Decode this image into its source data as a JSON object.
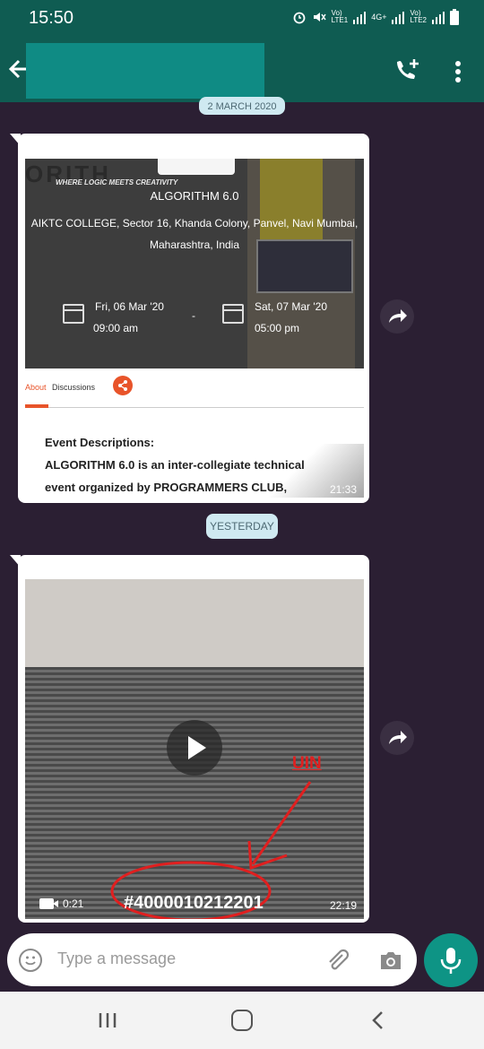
{
  "status_bar": {
    "time": "15:50",
    "sim1": "Vo)\nLTE1",
    "sim2": "Vo)\nLTE2",
    "network": "4G+"
  },
  "app_bar": {
    "back_icon": "arrow-left-icon",
    "call_icon": "add-call-icon",
    "menu_icon": "more-vertical-icon"
  },
  "chat": {
    "date_chip_1": "2 MARCH 2020",
    "message_1": {
      "image": {
        "brand_word": "ORITH",
        "tagline": "WHERE LOGIC MEETS CREATIVITY",
        "event_title": "ALGORITHM 6.0",
        "venue_line1": "AIKTC COLLEGE, Sector 16, Khanda Colony, Panvel, Navi Mumbai,",
        "venue_line2": "Maharashtra, India",
        "start_date": "Fri, 06 Mar '20",
        "start_time": "09:00 am",
        "separator": "-",
        "end_date": "Sat, 07 Mar '20",
        "end_time": "05:00 pm"
      },
      "tabs": {
        "about": "About",
        "discussions": "Discussions"
      },
      "desc_heading": "Event Descriptions:",
      "desc_line1": "ALGORITHM 6.0 is an inter-collegiate technical",
      "desc_line2": "event organized by PROGRAMMERS CLUB,",
      "timestamp": "21:33"
    },
    "date_chip_2": "YESTERDAY",
    "message_2": {
      "video_duration": "0:21",
      "timestamp": "22:19",
      "uin_code": "#4000010212201",
      "annotation_label": "UIN"
    }
  },
  "composer": {
    "placeholder": "Type a message"
  },
  "colors": {
    "header": "#0f5c52",
    "chat_bg": "#2b1f33",
    "accent": "#0e9485",
    "annotation": "#e01f1f",
    "orange": "#e8542a"
  }
}
